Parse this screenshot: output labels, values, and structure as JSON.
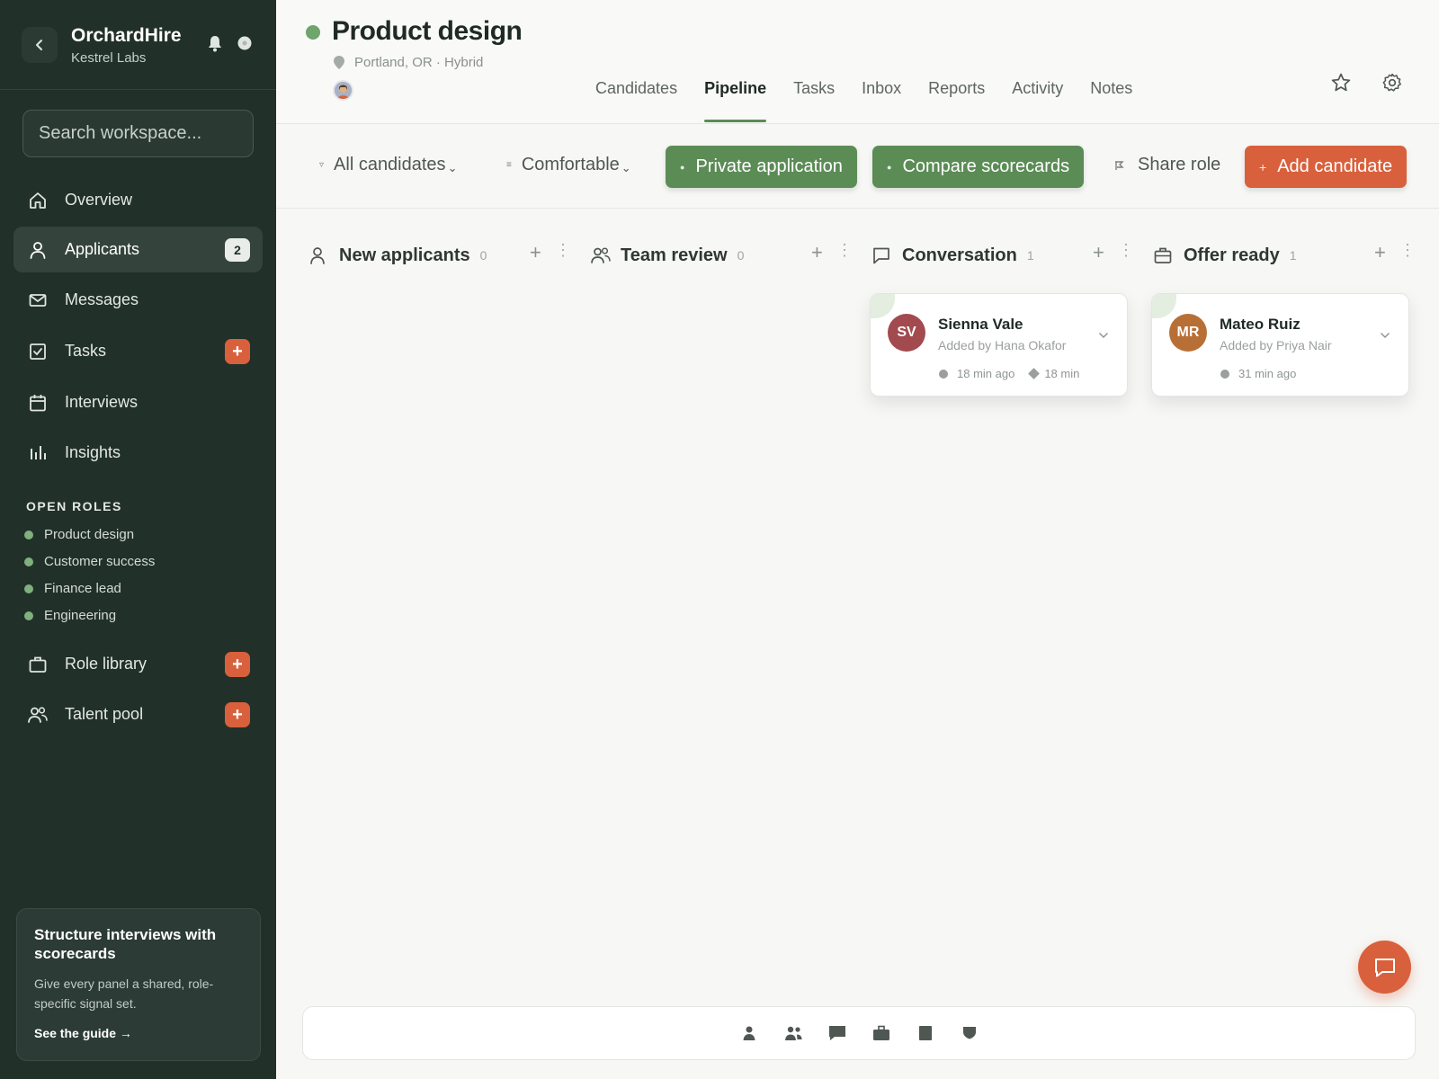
{
  "app": {
    "name": "OrchardHire",
    "workspace": "Kestrel Labs",
    "search_placeholder": "Search workspace..."
  },
  "sidebar": {
    "nav": [
      {
        "label": "Overview",
        "icon": "home-icon"
      },
      {
        "label": "Applicants",
        "icon": "user-icon",
        "badge": "2",
        "active": true
      },
      {
        "label": "Messages",
        "icon": "mail-icon"
      },
      {
        "label": "Tasks",
        "icon": "checkbox-icon",
        "badge": "+"
      },
      {
        "label": "Interviews",
        "icon": "calendar-icon"
      },
      {
        "label": "Insights",
        "icon": "bar-chart-icon"
      }
    ],
    "roles_heading": "OPEN ROLES",
    "roles": [
      "Product design",
      "Customer success",
      "Finance lead",
      "Engineering"
    ],
    "bottom_nav": [
      {
        "label": "Role library",
        "icon": "briefcase-icon",
        "badge": "+"
      },
      {
        "label": "Talent pool",
        "icon": "users-icon",
        "badge": "+"
      }
    ],
    "promo": {
      "title": "Structure interviews with scorecards",
      "body": "Give every panel a shared, role-specific signal set.",
      "link": "See the guide →"
    }
  },
  "header": {
    "title": "Product design",
    "location": "Portland, OR · Hybrid",
    "status_color": "#6fa46c",
    "tabs": [
      "Candidates",
      "Pipeline",
      "Tasks",
      "Inbox",
      "Reports",
      "Activity",
      "Notes"
    ],
    "active_tab": "Pipeline"
  },
  "toolbar": {
    "filter_candidates": "All candidates",
    "filter_density": "Comfortable",
    "private_application": "Private application",
    "compare_scorecards": "Compare scorecards",
    "share_role": "Share role",
    "add_candidate": "Add candidate"
  },
  "board": {
    "columns": [
      {
        "title": "New applicants",
        "count": "0",
        "icon": "user-icon"
      },
      {
        "title": "Team review",
        "count": "0",
        "icon": "users-icon"
      },
      {
        "title": "Conversation",
        "count": "1",
        "icon": "chat-icon"
      },
      {
        "title": "Offer ready",
        "count": "1",
        "icon": "briefcase-icon"
      }
    ],
    "cards": [
      {
        "column": 2,
        "initials": "SV",
        "name": "Sienna Vale",
        "added_by": "Added by Hana Okafor",
        "time": "18 min ago",
        "duration": "18 min",
        "color": "#a24a4e"
      },
      {
        "column": 3,
        "initials": "MR",
        "name": "Mateo Ruiz",
        "added_by": "Added by Priya Nair",
        "time": "31 min ago",
        "color": "#b86f36"
      }
    ]
  },
  "dock": {
    "icons": [
      "user-icon",
      "users-icon",
      "chat-icon",
      "briefcase-icon",
      "document-icon",
      "shield-icon"
    ]
  },
  "colors": {
    "sidebar_bg": "#213029",
    "accent_green": "#5c8c56",
    "accent_orange": "#d9603c"
  }
}
